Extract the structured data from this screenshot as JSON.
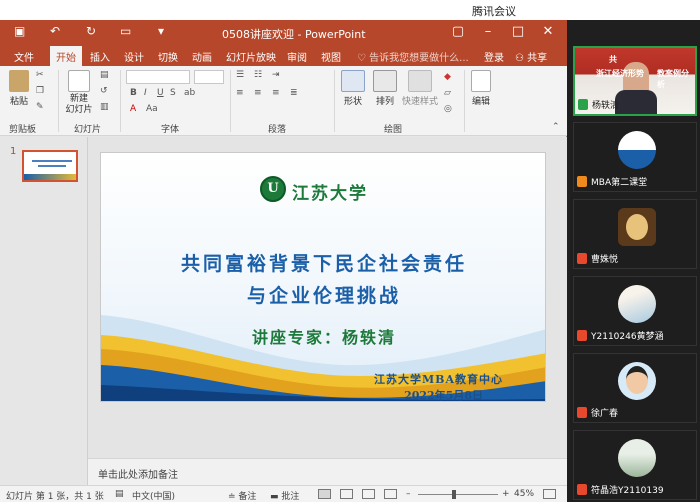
{
  "meeting": {
    "title": "腾讯会议"
  },
  "ppt": {
    "doc_title": "0508讲座欢迎 - PowerPoint",
    "tabs": [
      "文件",
      "开始",
      "插入",
      "设计",
      "切换",
      "动画",
      "幻灯片放映",
      "审阅",
      "视图"
    ],
    "active_tab": "开始",
    "tell_me": "告诉我您想要做什么...",
    "login": "登录",
    "share": "共享",
    "ribbon": {
      "paste": "粘贴",
      "new_slide": "新建\n幻灯片",
      "shape": "形状",
      "arrange": "排列",
      "quick_style": "快速样式",
      "edit": "编辑",
      "groups": [
        "剪贴板",
        "幻灯片",
        "字体",
        "段落",
        "绘图"
      ]
    },
    "thumb_number": "1",
    "slide": {
      "university": "江苏大学",
      "title_line1": "共同富裕背景下民企社会责任",
      "title_line2": "与企业伦理挑战",
      "lecturer": "讲座专家：杨轶清",
      "org": "江苏大学MBA教育中心",
      "date": "2022年5月8日"
    },
    "notes_placeholder": "单击此处添加备注",
    "status": {
      "slide_info": "幻灯片 第 1 张，共 1 张",
      "language": "中文(中国)",
      "notes": "备注",
      "comments": "批注",
      "zoom": "45%"
    }
  },
  "participants": [
    {
      "name": "杨轶清",
      "overlay1": "共",
      "overlay2": "浙江经济形势",
      "overlay3": "教案例分析",
      "active": true
    },
    {
      "name": "MBA第二课堂"
    },
    {
      "name": "曹姝悦"
    },
    {
      "name": "Y2110246黄梦涵"
    },
    {
      "name": "徐广春"
    },
    {
      "name": "符晶浩Y2110139"
    }
  ],
  "colors": {
    "ppt_red": "#b7472a",
    "accent_green": "#2aa24a",
    "slide_blue": "#1b5fa8"
  }
}
